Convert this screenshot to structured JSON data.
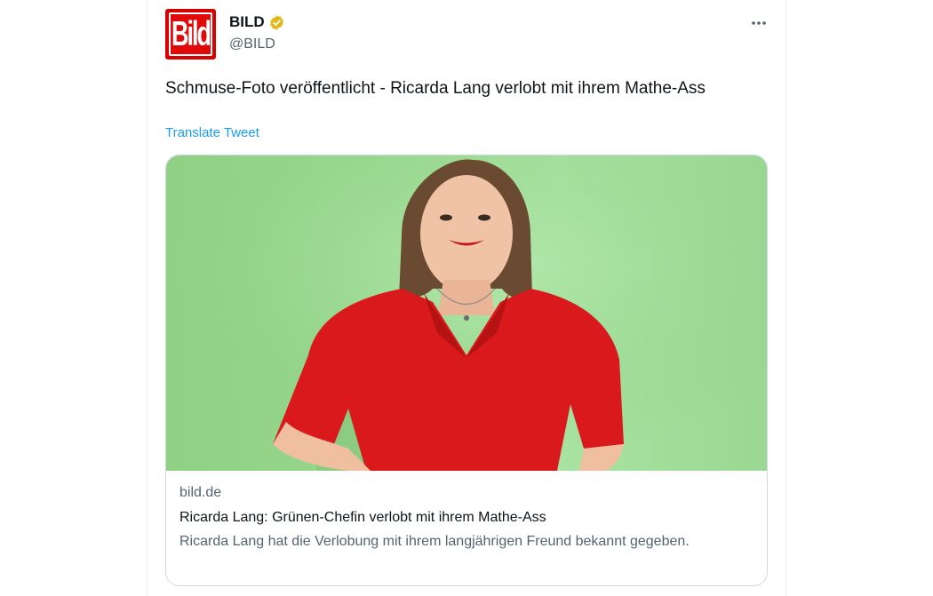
{
  "tweet": {
    "author": {
      "name": "BILD",
      "handle": "@BILD",
      "avatar_text": "Bild",
      "verified": true
    },
    "text": "Schmuse-Foto veröffentlicht - Ricarda Lang verlobt mit ihrem Mathe-Ass",
    "translate_label": "Translate Tweet",
    "card": {
      "domain": "bild.de",
      "title": "Ricarda Lang: Grünen-Chefin verlobt mit ihrem Mathe-Ass",
      "description": "Ricarda Lang hat die Verlobung mit ihrem langjährigen Freund bekannt gegeben."
    }
  },
  "icons": {
    "verified": "verified-badge-icon",
    "more": "more-options-icon"
  },
  "colors": {
    "accent": "#1d9bf0",
    "verified_gold": "#e2b719",
    "brand_red": "#d90000",
    "secondary_text": "#536471"
  }
}
